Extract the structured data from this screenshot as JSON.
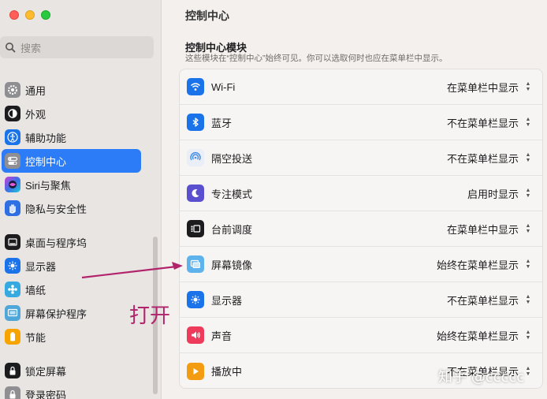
{
  "window": {
    "title": "控制中心"
  },
  "sidebar": {
    "search_placeholder": "搜索",
    "items": [
      {
        "label": "通用",
        "icon": "gear-icon"
      },
      {
        "label": "外观",
        "icon": "appearance-icon"
      },
      {
        "label": "辅助功能",
        "icon": "accessibility-icon"
      },
      {
        "label": "控制中心",
        "icon": "control-center-icon",
        "active": true
      },
      {
        "label": "Siri与聚焦",
        "icon": "siri-icon"
      },
      {
        "label": "隐私与安全性",
        "icon": "hand-icon"
      },
      {
        "label": "桌面与程序坞",
        "icon": "dock-icon"
      },
      {
        "label": "显示器",
        "icon": "display-icon"
      },
      {
        "label": "墙纸",
        "icon": "wallpaper-icon"
      },
      {
        "label": "屏幕保护程序",
        "icon": "screensaver-icon"
      },
      {
        "label": "节能",
        "icon": "battery-icon"
      },
      {
        "label": "锁定屏幕",
        "icon": "lock-icon"
      },
      {
        "label": "登录密码",
        "icon": "password-icon"
      }
    ]
  },
  "main": {
    "section_title": "控制中心模块",
    "section_desc": "这些模块在“控制中心”始终可见。你可以选取何时也应在菜单栏中显示。",
    "rows": [
      {
        "label": "Wi-Fi",
        "value": "在菜单栏中显示",
        "icon": "wifi-icon"
      },
      {
        "label": "蓝牙",
        "value": "不在菜单栏显示",
        "icon": "bluetooth-icon"
      },
      {
        "label": "隔空投送",
        "value": "不在菜单栏显示",
        "icon": "airdrop-icon"
      },
      {
        "label": "专注模式",
        "value": "启用时显示",
        "icon": "moon-icon"
      },
      {
        "label": "台前调度",
        "value": "在菜单栏中显示",
        "icon": "stage-manager-icon"
      },
      {
        "label": "屏幕镜像",
        "value": "始终在菜单栏显示",
        "icon": "screen-mirroring-icon"
      },
      {
        "label": "显示器",
        "value": "不在菜单栏显示",
        "icon": "brightness-icon"
      },
      {
        "label": "声音",
        "value": "始终在菜单栏显示",
        "icon": "speaker-icon"
      },
      {
        "label": "播放中",
        "value": "不在菜单栏显示",
        "icon": "play-icon"
      }
    ]
  },
  "annotation": {
    "text": "打开",
    "color": "#b1236b"
  },
  "watermark": {
    "text": "知乎 @ccccc"
  }
}
